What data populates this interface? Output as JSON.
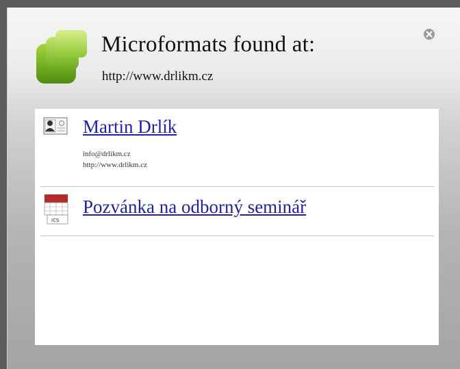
{
  "header": {
    "title": "Microformats found at:",
    "url": "http://www.drlikm.cz",
    "logo_icon": "microformats-logo-icon",
    "close_icon": "close-icon"
  },
  "items": [
    {
      "icon": "vcard-contact-icon",
      "label": "Martin Drlík",
      "details": [
        "info@drlikm.cz",
        "http://www.drlikm.cz"
      ]
    },
    {
      "icon": "ics-calendar-icon",
      "icon_text": "ICS",
      "label": "Pozvánka na odborný seminář"
    }
  ],
  "colors": {
    "logo_green": "#7fbf1f",
    "link": "#1f1fa8",
    "calendar_red": "#b52a2a"
  }
}
